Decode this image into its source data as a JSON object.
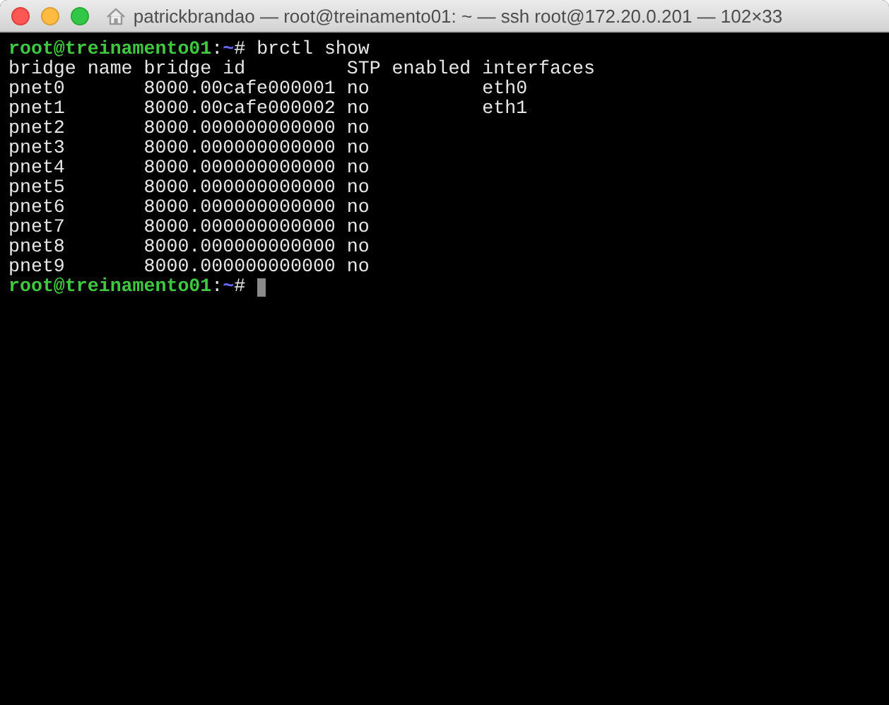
{
  "window": {
    "title": "patrickbrandao — root@treinamento01: ~ — ssh root@172.20.0.201 — 102×33"
  },
  "terminal": {
    "command_prompt": {
      "user_host": "root@treinamento01",
      "separator": ":",
      "path": "~",
      "symbol": "#",
      "command": "brctl show"
    },
    "table": {
      "columns": [
        "bridge name",
        "bridge id",
        "STP enabled",
        "interfaces"
      ],
      "rows": [
        [
          "pnet0",
          "8000.00cafe000001",
          "no",
          "eth0"
        ],
        [
          "pnet1",
          "8000.00cafe000002",
          "no",
          "eth1"
        ],
        [
          "pnet2",
          "8000.000000000000",
          "no",
          ""
        ],
        [
          "pnet3",
          "8000.000000000000",
          "no",
          ""
        ],
        [
          "pnet4",
          "8000.000000000000",
          "no",
          ""
        ],
        [
          "pnet5",
          "8000.000000000000",
          "no",
          ""
        ],
        [
          "pnet6",
          "8000.000000000000",
          "no",
          ""
        ],
        [
          "pnet7",
          "8000.000000000000",
          "no",
          ""
        ],
        [
          "pnet8",
          "8000.000000000000",
          "no",
          ""
        ],
        [
          "pnet9",
          "8000.000000000000",
          "no",
          ""
        ]
      ]
    },
    "final_prompt": {
      "user_host": "root@treinamento01",
      "separator": ":",
      "path": "~",
      "symbol": "#"
    }
  }
}
